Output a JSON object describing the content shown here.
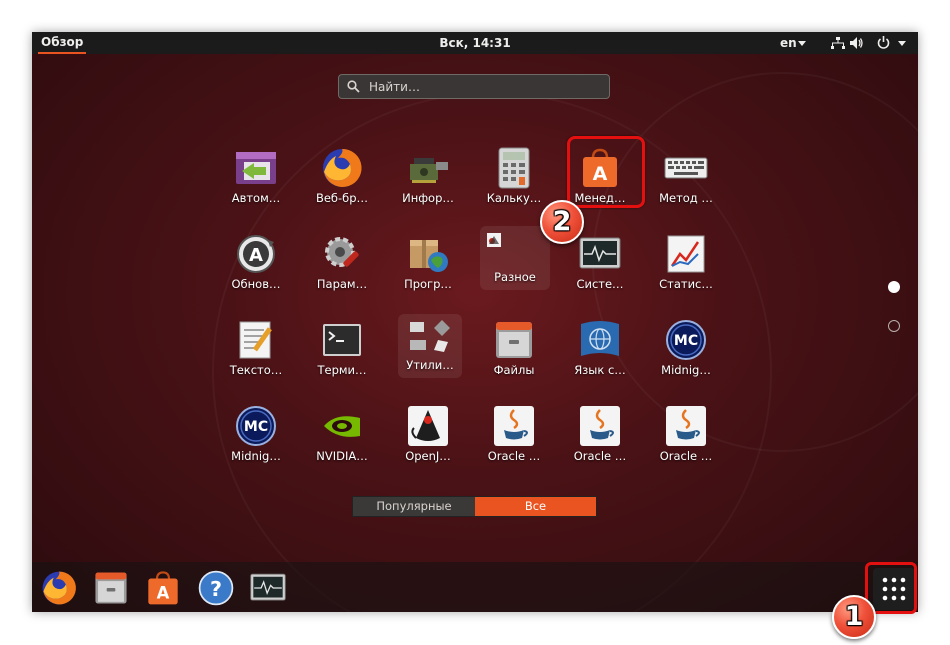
{
  "topbar": {
    "activities": "Обзор",
    "clock": "Вск, 14:31",
    "language": "en"
  },
  "search": {
    "placeholder": "Найти…"
  },
  "apps": [
    {
      "label": "Автом…",
      "icon": "autostart-icon"
    },
    {
      "label": "Веб-бр…",
      "icon": "firefox-icon"
    },
    {
      "label": "Инфор…",
      "icon": "system-info-icon"
    },
    {
      "label": "Кальку…",
      "icon": "calculator-icon"
    },
    {
      "label": "Менед…",
      "icon": "software-center-icon"
    },
    {
      "label": "Метод …",
      "icon": "keyboard-icon"
    },
    {
      "label": "Обнов…",
      "icon": "software-updater-icon"
    },
    {
      "label": "Парам…",
      "icon": "settings-icon"
    },
    {
      "label": "Прогр…",
      "icon": "software-properties-icon"
    },
    {
      "label": "Разное",
      "icon": "misc-folder-icon"
    },
    {
      "label": "Систе…",
      "icon": "system-monitor-icon"
    },
    {
      "label": "Статис…",
      "icon": "statistics-icon"
    },
    {
      "label": "Тексто…",
      "icon": "text-editor-icon"
    },
    {
      "label": "Терми…",
      "icon": "terminal-icon"
    },
    {
      "label": "Утили…",
      "icon": "utilities-folder-icon"
    },
    {
      "label": "Файлы",
      "icon": "files-icon"
    },
    {
      "label": "Язык с…",
      "icon": "language-support-icon"
    },
    {
      "label": "Midnig…",
      "icon": "midnight-commander-icon"
    },
    {
      "label": "Midnig…",
      "icon": "midnight-commander-icon"
    },
    {
      "label": "NVIDIA…",
      "icon": "nvidia-icon"
    },
    {
      "label": "OpenJ…",
      "icon": "java-duke-icon"
    },
    {
      "label": "Oracle …",
      "icon": "java-icon"
    },
    {
      "label": "Oracle …",
      "icon": "java-icon"
    },
    {
      "label": "Oracle …",
      "icon": "java-icon"
    }
  ],
  "view_toggle": {
    "popular": "Популярные",
    "all": "Все",
    "active": "all"
  },
  "dock": [
    {
      "icon": "firefox-icon"
    },
    {
      "icon": "files-icon"
    },
    {
      "icon": "software-center-icon"
    },
    {
      "icon": "help-icon"
    },
    {
      "icon": "system-monitor-icon"
    },
    {
      "icon": "show-applications-icon"
    }
  ],
  "annotations": {
    "marker_1": "1",
    "marker_2": "2"
  },
  "colors": {
    "accent": "#e95420",
    "highlight": "#e41010",
    "topbar": "#1c1b1b"
  }
}
